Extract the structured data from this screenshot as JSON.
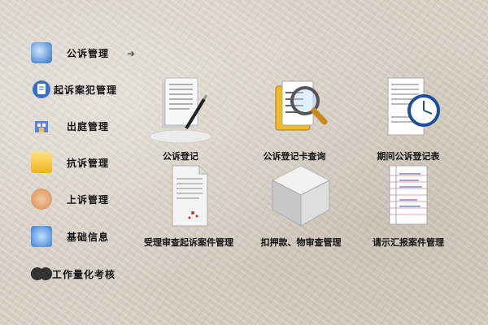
{
  "sidebar": {
    "items": [
      {
        "label": "公诉管理",
        "icon": "monitor-icon"
      },
      {
        "label": "起诉案犯管理",
        "icon": "document-icon"
      },
      {
        "label": "出庭管理",
        "icon": "building-icon"
      },
      {
        "label": "抗诉管理",
        "icon": "folder-icon"
      },
      {
        "label": "上诉管理",
        "icon": "hand-icon"
      },
      {
        "label": "基础信息",
        "icon": "refresh-icon"
      },
      {
        "label": "工作量化考核",
        "icon": "binoculars-icon"
      }
    ],
    "active_arrow": "➜"
  },
  "tiles": [
    {
      "label": "公诉登记",
      "icon": "document-pen-icon"
    },
    {
      "label": "公诉登记卡查询",
      "icon": "magnifier-icon"
    },
    {
      "label": "期间公诉登记表",
      "icon": "document-clock-icon"
    },
    {
      "label": "受理审查起诉案件管理",
      "icon": "document-icon"
    },
    {
      "label": "扣押款、物审查管理",
      "icon": "cube-icon"
    },
    {
      "label": "请示汇报案件管理",
      "icon": "notepad-icon"
    }
  ]
}
